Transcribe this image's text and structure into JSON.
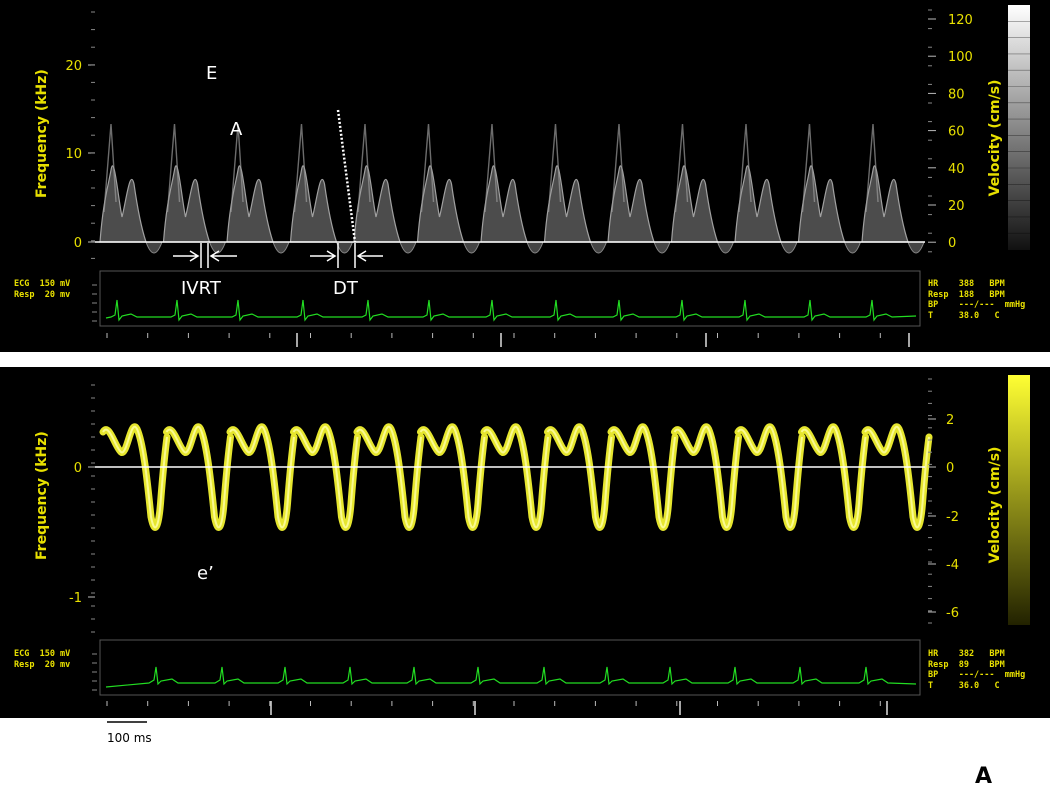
{
  "panels": {
    "top": {
      "left_axis_label": "Frequency (kHz)",
      "right_axis_label": "Velocity (cm/s)",
      "left_ticks": [
        "20",
        "10",
        "0"
      ],
      "right_ticks": [
        "120",
        "100",
        "80",
        "60",
        "40",
        "20",
        "0"
      ],
      "annotations": {
        "E": "E",
        "A": "A",
        "IVRT": "IVRT",
        "DT": "DT"
      },
      "ecg": {
        "line1": "ECG  150 mV",
        "line2": "Resp  20 mv"
      },
      "vitals": {
        "hr": "HR    388   BPM",
        "resp": "Resp  188   BPM",
        "bp": "BP    ---/---  mmHg",
        "t": "T     38.0   C"
      },
      "color_scale": "grayscale"
    },
    "bottom": {
      "left_axis_label": "Frequency (kHz)",
      "right_axis_label": "Velocity (cm/s)",
      "left_ticks": [
        "0",
        "-1"
      ],
      "right_ticks": [
        "2",
        "0",
        "-2",
        "-4",
        "-6"
      ],
      "annotations": {
        "e_prime": "e’"
      },
      "ecg": {
        "line1": "ECG  150 mV",
        "line2": "Resp  20 mv"
      },
      "vitals": {
        "hr": "HR    382   BPM",
        "resp": "Resp  89    BPM",
        "bp": "BP    ---/---  mmHg",
        "t": "T     36.0   C"
      },
      "color_scale": "yellow"
    }
  },
  "scale_bar": {
    "label": "100 ms"
  },
  "panel_letter": "A",
  "colors": {
    "background": "#000000",
    "axis_text": "#e8e000",
    "ecg_trace": "#22dd22",
    "tissue_doppler": "#ffff33",
    "pulsed_doppler": "#d8d8d8"
  }
}
